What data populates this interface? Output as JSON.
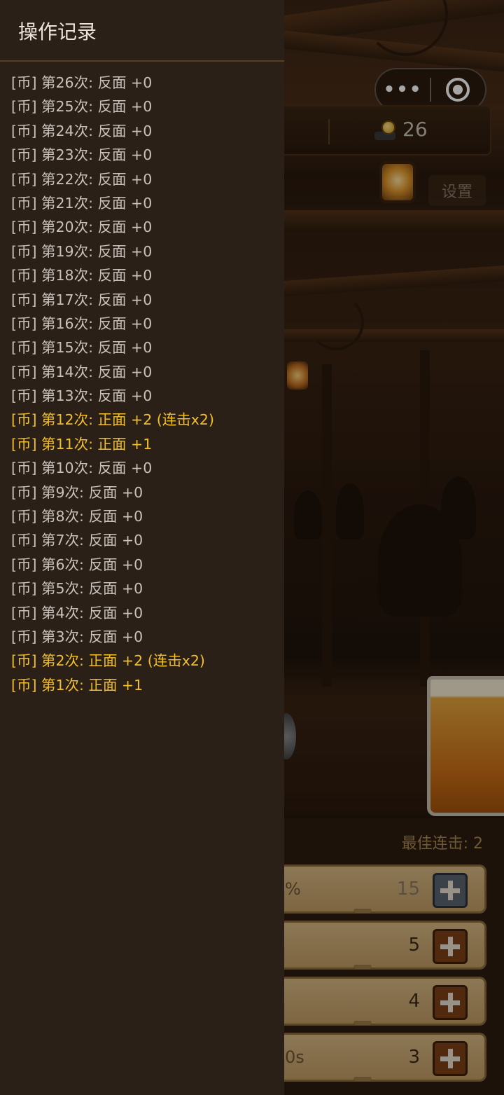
{
  "drawer": {
    "title": "操作记录",
    "log": [
      {
        "text": "[币] 第26次: 反面 +0",
        "highlight": false
      },
      {
        "text": "[币] 第25次: 反面 +0",
        "highlight": false
      },
      {
        "text": "[币] 第24次: 反面 +0",
        "highlight": false
      },
      {
        "text": "[币] 第23次: 反面 +0",
        "highlight": false
      },
      {
        "text": "[币] 第22次: 反面 +0",
        "highlight": false
      },
      {
        "text": "[币] 第21次: 反面 +0",
        "highlight": false
      },
      {
        "text": "[币] 第20次: 反面 +0",
        "highlight": false
      },
      {
        "text": "[币] 第19次: 反面 +0",
        "highlight": false
      },
      {
        "text": "[币] 第18次: 反面 +0",
        "highlight": false
      },
      {
        "text": "[币] 第17次: 反面 +0",
        "highlight": false
      },
      {
        "text": "[币] 第16次: 反面 +0",
        "highlight": false
      },
      {
        "text": "[币] 第15次: 反面 +0",
        "highlight": false
      },
      {
        "text": "[币] 第14次: 反面 +0",
        "highlight": false
      },
      {
        "text": "[币] 第13次: 反面 +0",
        "highlight": false
      },
      {
        "text": "[币] 第12次: 正面 +2 (连击x2)",
        "highlight": true
      },
      {
        "text": "[币] 第11次: 正面 +1",
        "highlight": true
      },
      {
        "text": "[币] 第10次: 反面 +0",
        "highlight": false
      },
      {
        "text": "[币] 第9次: 反面 +0",
        "highlight": false
      },
      {
        "text": "[币] 第8次: 反面 +0",
        "highlight": false
      },
      {
        "text": "[币] 第7次: 反面 +0",
        "highlight": false
      },
      {
        "text": "[币] 第6次: 反面 +0",
        "highlight": false
      },
      {
        "text": "[币] 第5次: 反面 +0",
        "highlight": false
      },
      {
        "text": "[币] 第4次: 反面 +0",
        "highlight": false
      },
      {
        "text": "[币] 第3次: 反面 +0",
        "highlight": false
      },
      {
        "text": "[币] 第2次: 正面 +2 (连击x2)",
        "highlight": true
      },
      {
        "text": "[币] 第1次: 正面 +1",
        "highlight": true
      }
    ],
    "colors": {
      "normal": "#c9c2bb",
      "highlight": "#f2bf2a"
    }
  },
  "hud": {
    "coin_count": "26",
    "settings_label": "设置",
    "capsule_more_icon": "more-dots-icon",
    "capsule_target_icon": "target-icon"
  },
  "panel": {
    "best_combo": "最佳连击: 2",
    "upgrades": [
      {
        "label_fragment": "%",
        "value": "15",
        "disabled": true
      },
      {
        "label_fragment": "",
        "value": "5",
        "disabled": false
      },
      {
        "label_fragment": "",
        "value": "4",
        "disabled": false
      },
      {
        "label_fragment": "0s",
        "value": "3",
        "disabled": false
      }
    ]
  }
}
